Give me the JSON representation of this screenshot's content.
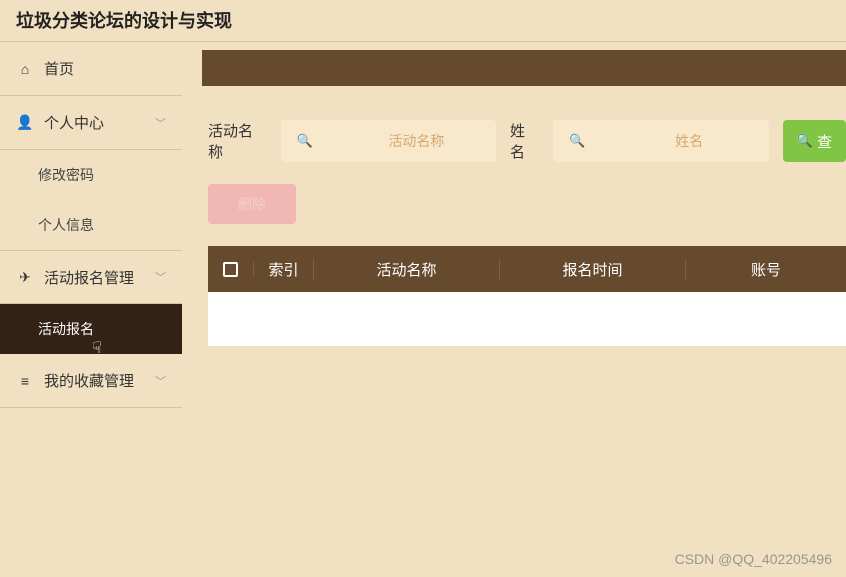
{
  "header": {
    "title": "垃圾分类论坛的设计与实现"
  },
  "sidebar": {
    "home": "首页",
    "personal": "个人中心",
    "personal_children": {
      "change_pwd": "修改密码",
      "personal_info": "个人信息"
    },
    "activity": "活动报名管理",
    "activity_children": {
      "signup": "活动报名"
    },
    "favorites": "我的收藏管理"
  },
  "filters": {
    "activity_name_label": "活动名称",
    "activity_name_placeholder": "活动名称",
    "name_label": "姓名",
    "name_placeholder": "姓名",
    "search_btn": "查",
    "delete_btn": "删除"
  },
  "table": {
    "columns": {
      "index": "索引",
      "activity_name": "活动名称",
      "signup_time": "报名时间",
      "account": "账号"
    }
  },
  "watermark": "CSDN @QQ_402205496"
}
